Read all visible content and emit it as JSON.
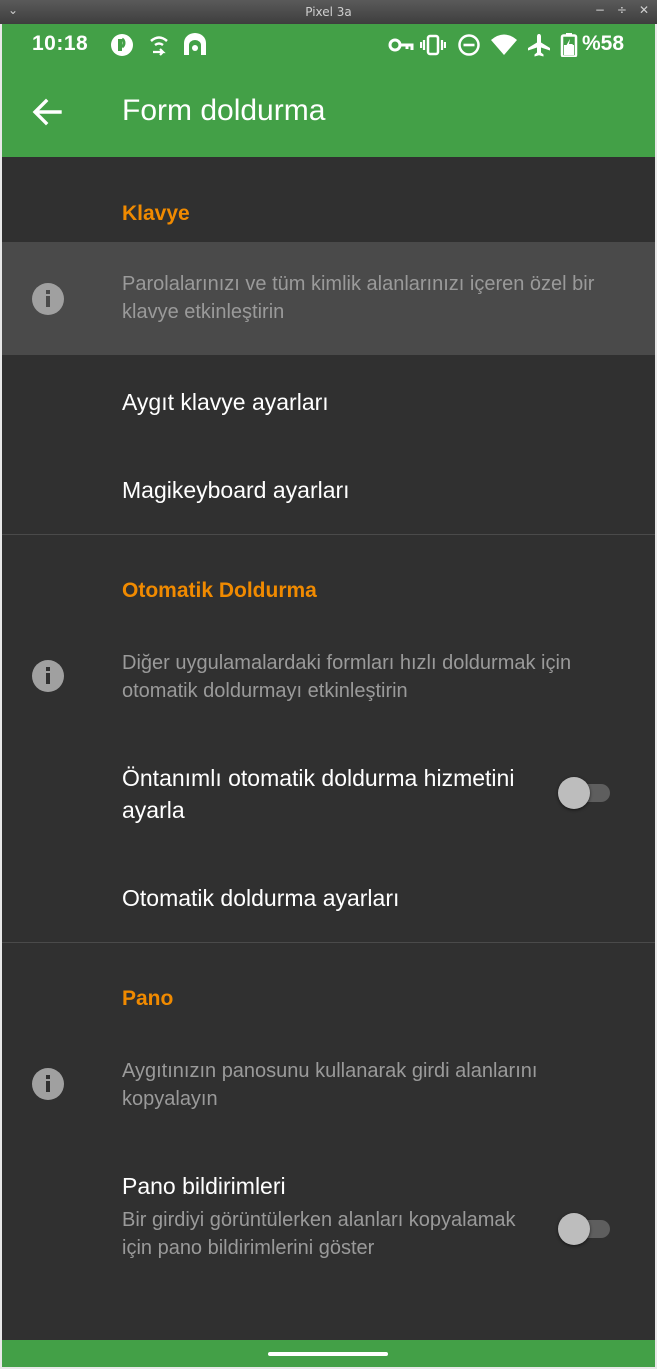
{
  "window": {
    "title": "Pixel 3a",
    "menu_glyph": "⌄",
    "buttons": [
      "−",
      "÷",
      "✕"
    ]
  },
  "status_bar": {
    "time": "10:18",
    "battery": "%58",
    "icons": [
      "app-badge-icon",
      "data-saver-icon",
      "privacy-icon",
      "vpn-key-icon",
      "vibrate-icon",
      "do-not-disturb-icon",
      "wifi-icon",
      "airplane-icon",
      "battery-icon"
    ]
  },
  "app_bar": {
    "title": "Form doldurma"
  },
  "sections": {
    "keyboard": {
      "header": "Klavye",
      "info": "Parolalarınızı ve tüm kimlik alanlarınızı içeren özel bir klavye etkinleştirin",
      "device_settings": "Aygıt klavye ayarları",
      "magikeyboard_settings": "Magikeyboard ayarları"
    },
    "autofill": {
      "header": "Otomatik Doldurma",
      "info": "Diğer uygulamalardaki formları hızlı doldurmak için otomatik doldurmayı etkinleştirin",
      "default_service": "Öntanımlı otomatik doldurma hizmetini ayarla",
      "default_service_enabled": false,
      "autofill_settings": "Otomatik doldurma ayarları"
    },
    "clipboard": {
      "header": "Pano",
      "info": "Aygıtınızın panosunu kullanarak girdi alanlarını kopyalayın",
      "notifications_title": "Pano bildirimleri",
      "notifications_summary": "Bir girdiyi görüntülerken alanları kopyalamak için pano bildirimlerini göster",
      "notifications_enabled": false
    }
  },
  "colors": {
    "accent": "#43a047",
    "section_header": "#f08a00",
    "background": "#303030"
  }
}
